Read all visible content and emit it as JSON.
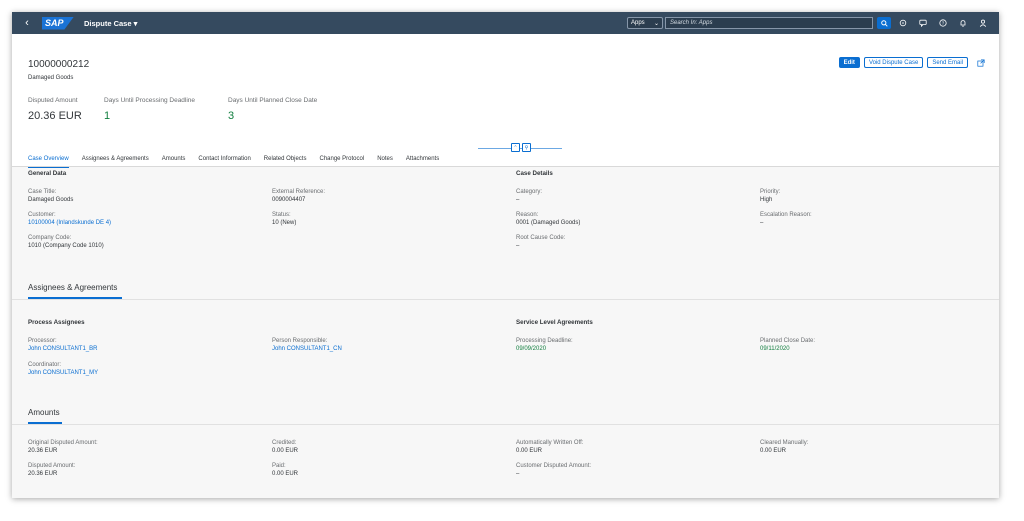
{
  "shell": {
    "title": "Dispute Case ▾",
    "logo": "SAP",
    "apps_label": "Apps",
    "search_placeholder": "Search In: Apps",
    "icons": [
      "search-icon",
      "bell-settings-icon",
      "chat-icon",
      "help-icon",
      "notification-icon",
      "user-icon"
    ]
  },
  "header": {
    "case_number": "10000000212",
    "case_subtitle": "Damaged Goods",
    "actions": {
      "edit": "Edit",
      "void": "Void Dispute Case",
      "email": "Send Email"
    },
    "kpis": [
      {
        "label": "Disputed Amount",
        "value": "20.36  EUR",
        "color": "#32363a"
      },
      {
        "label": "Days Until Processing Deadline",
        "value": "1",
        "color": "#107e3e"
      },
      {
        "label": "Days Until Planned Close Date",
        "value": "3",
        "color": "#107e3e"
      }
    ]
  },
  "tabs": [
    "Case Overview",
    "Assignees & Agreements",
    "Amounts",
    "Contact Information",
    "Related Objects",
    "Change Protocol",
    "Notes",
    "Attachments"
  ],
  "overview": {
    "general_title": "General Data",
    "case_details_title": "Case Details",
    "fields": {
      "case_title": {
        "label": "Case Title:",
        "value": "Damaged Goods"
      },
      "external_ref": {
        "label": "External Reference:",
        "value": "0090004407"
      },
      "category": {
        "label": "Category:",
        "value": "–"
      },
      "priority": {
        "label": "Priority:",
        "value": "High"
      },
      "customer": {
        "label": "Customer:",
        "value": "10100004 (Inlandskunde DE 4)"
      },
      "status": {
        "label": "Status:",
        "value": "10 (New)"
      },
      "reason": {
        "label": "Reason:",
        "value": "0001 (Damaged Goods)"
      },
      "escalation": {
        "label": "Escalation Reason:",
        "value": "–"
      },
      "company_code": {
        "label": "Company Code:",
        "value": "1010 (Company Code 1010)"
      },
      "root_cause": {
        "label": "Root Cause Code:",
        "value": "–"
      }
    }
  },
  "assignees": {
    "section_title": "Assignees & Agreements",
    "process_title": "Process Assignees",
    "sla_title": "Service Level Agreements",
    "fields": {
      "processor": {
        "label": "Processor:",
        "value": "John CONSULTANT1_BR"
      },
      "responsible": {
        "label": "Person Responsible:",
        "value": "John CONSULTANT1_CN"
      },
      "deadline": {
        "label": "Processing Deadline:",
        "value": "09/09/2020"
      },
      "planned_close": {
        "label": "Planned Close Date:",
        "value": "09/11/2020"
      },
      "coordinator": {
        "label": "Coordinator:",
        "value": "John CONSULTANT1_MY"
      }
    }
  },
  "amounts": {
    "section_title": "Amounts",
    "fields": {
      "original": {
        "label": "Original Disputed Amount:",
        "value": "20.36  EUR"
      },
      "credited": {
        "label": "Credited:",
        "value": "0.00  EUR"
      },
      "auto_written": {
        "label": "Automatically Written Off:",
        "value": "0.00  EUR"
      },
      "cleared": {
        "label": "Cleared Manually:",
        "value": "0.00  EUR"
      },
      "disputed": {
        "label": "Disputed Amount:",
        "value": "20.36  EUR"
      },
      "paid": {
        "label": "Paid:",
        "value": "0.00  EUR"
      },
      "customer_disputed": {
        "label": "Customer Disputed Amount:",
        "value": "–"
      }
    }
  }
}
